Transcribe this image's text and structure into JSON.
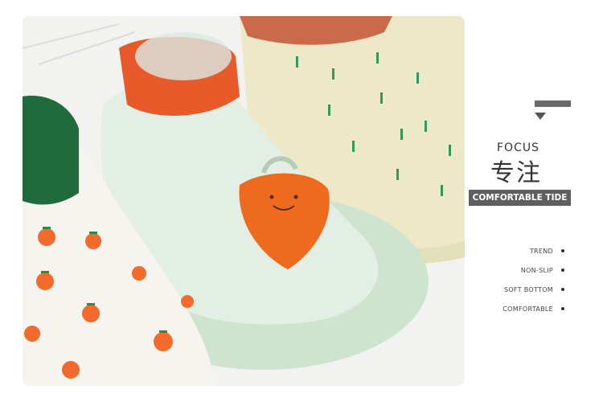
{
  "side_panel": {
    "title_en": "FOCUS",
    "title_cn": "专注",
    "badge": "COMFORTABLE TIDE",
    "features": [
      "TREND",
      "NON-SLIP",
      "SOFT BOTTOM",
      "COMFORTABLE"
    ]
  },
  "colors": {
    "accent_gray": "#5f5f5f",
    "sock_orange": "#e85a2a",
    "sock_green": "#1f7a4a",
    "sole_mint": "#cfe4cf"
  }
}
